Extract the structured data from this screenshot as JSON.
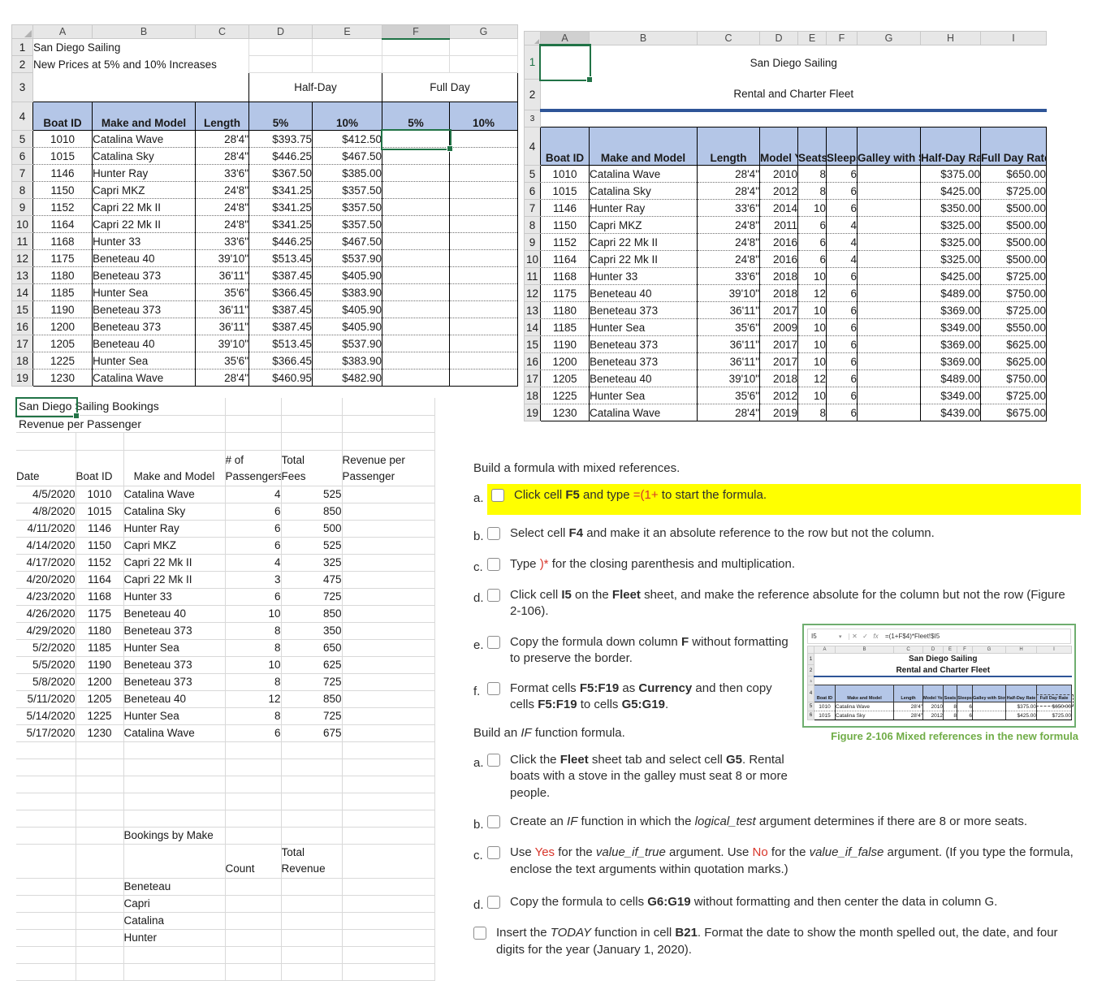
{
  "colors": {
    "selection_green": "#217346",
    "header_fill_blue": "#b4c6e7",
    "title_rule_blue": "#2e5597",
    "highlight_yellow": "#ffff00",
    "red_text": "#d8352a",
    "caption_green": "#70ad47"
  },
  "price_sheet": {
    "cols": [
      "A",
      "B",
      "C",
      "D",
      "E",
      "F",
      "G"
    ],
    "gutter": [
      "1",
      "2",
      "3",
      "4"
    ],
    "title": "San Diego Sailing",
    "subtitle": "New Prices at 5% and 10% Increases",
    "group_half": "Half-Day",
    "group_full": "Full Day",
    "headers": [
      "Boat ID",
      "Make and Model",
      "Length",
      "5%",
      "10%",
      "5%",
      "10%"
    ],
    "rows": [
      [
        "5",
        "1010",
        "Catalina Wave",
        "28'4\"",
        "$393.75",
        "$412.50"
      ],
      [
        "6",
        "1015",
        "Catalina Sky",
        "28'4\"",
        "$446.25",
        "$467.50"
      ],
      [
        "7",
        "1146",
        "Hunter Ray",
        "33'6\"",
        "$367.50",
        "$385.00"
      ],
      [
        "8",
        "1150",
        "Capri MKZ",
        "24'8\"",
        "$341.25",
        "$357.50"
      ],
      [
        "9",
        "1152",
        "Capri 22 Mk II",
        "24'8\"",
        "$341.25",
        "$357.50"
      ],
      [
        "10",
        "1164",
        "Capri 22 Mk II",
        "24'8\"",
        "$341.25",
        "$357.50"
      ],
      [
        "11",
        "1168",
        "Hunter 33",
        "33'6\"",
        "$446.25",
        "$467.50"
      ],
      [
        "12",
        "1175",
        "Beneteau 40",
        "39'10\"",
        "$513.45",
        "$537.90"
      ],
      [
        "13",
        "1180",
        "Beneteau 373",
        "36'11\"",
        "$387.45",
        "$405.90"
      ],
      [
        "14",
        "1185",
        "Hunter Sea",
        "35'6\"",
        "$366.45",
        "$383.90"
      ],
      [
        "15",
        "1190",
        "Beneteau 373",
        "36'11\"",
        "$387.45",
        "$405.90"
      ],
      [
        "16",
        "1200",
        "Beneteau 373",
        "36'11\"",
        "$387.45",
        "$405.90"
      ],
      [
        "17",
        "1205",
        "Beneteau 40",
        "39'10\"",
        "$513.45",
        "$537.90"
      ],
      [
        "18",
        "1225",
        "Hunter Sea",
        "35'6\"",
        "$366.45",
        "$383.90"
      ],
      [
        "19",
        "1230",
        "Catalina Wave",
        "28'4\"",
        "$460.95",
        "$482.90"
      ]
    ]
  },
  "fleet_sheet": {
    "cols": [
      "A",
      "B",
      "C",
      "D",
      "E",
      "F",
      "G",
      "H",
      "I"
    ],
    "gutter": [
      "1",
      "2",
      "3",
      "4"
    ],
    "title": "San Diego Sailing",
    "subtitle": "Rental and Charter Fleet",
    "headers": [
      "Boat ID",
      "Make and Model",
      "Length",
      "Model\nYear",
      "Seats",
      "Sleeps",
      "Galley\nwith Stove",
      "Half-Day\nRate",
      "Full Day\nRate"
    ],
    "rows": [
      [
        "5",
        "1010",
        "Catalina Wave",
        "28'4\"",
        "2010",
        "8",
        "6",
        "",
        "$375.00",
        "$650.00"
      ],
      [
        "6",
        "1015",
        "Catalina Sky",
        "28'4\"",
        "2012",
        "8",
        "6",
        "",
        "$425.00",
        "$725.00"
      ],
      [
        "7",
        "1146",
        "Hunter Ray",
        "33'6\"",
        "2014",
        "10",
        "6",
        "",
        "$350.00",
        "$500.00"
      ],
      [
        "8",
        "1150",
        "Capri MKZ",
        "24'8\"",
        "2011",
        "6",
        "4",
        "",
        "$325.00",
        "$500.00"
      ],
      [
        "9",
        "1152",
        "Capri 22 Mk II",
        "24'8\"",
        "2016",
        "6",
        "4",
        "",
        "$325.00",
        "$500.00"
      ],
      [
        "10",
        "1164",
        "Capri 22 Mk II",
        "24'8\"",
        "2016",
        "6",
        "4",
        "",
        "$325.00",
        "$500.00"
      ],
      [
        "11",
        "1168",
        "Hunter 33",
        "33'6\"",
        "2018",
        "10",
        "6",
        "",
        "$425.00",
        "$725.00"
      ],
      [
        "12",
        "1175",
        "Beneteau 40",
        "39'10\"",
        "2018",
        "12",
        "6",
        "",
        "$489.00",
        "$750.00"
      ],
      [
        "13",
        "1180",
        "Beneteau 373",
        "36'11\"",
        "2017",
        "10",
        "6",
        "",
        "$369.00",
        "$725.00"
      ],
      [
        "14",
        "1185",
        "Hunter Sea",
        "35'6\"",
        "2009",
        "10",
        "6",
        "",
        "$349.00",
        "$550.00"
      ],
      [
        "15",
        "1190",
        "Beneteau 373",
        "36'11\"",
        "2017",
        "10",
        "6",
        "",
        "$369.00",
        "$625.00"
      ],
      [
        "16",
        "1200",
        "Beneteau 373",
        "36'11\"",
        "2017",
        "10",
        "6",
        "",
        "$369.00",
        "$625.00"
      ],
      [
        "17",
        "1205",
        "Beneteau 40",
        "39'10\"",
        "2018",
        "12",
        "6",
        "",
        "$489.00",
        "$750.00"
      ],
      [
        "18",
        "1225",
        "Hunter Sea",
        "35'6\"",
        "2012",
        "10",
        "6",
        "",
        "$349.00",
        "$725.00"
      ],
      [
        "19",
        "1230",
        "Catalina Wave",
        "28'4\"",
        "2019",
        "8",
        "6",
        "",
        "$439.00",
        "$675.00"
      ]
    ]
  },
  "bookings_sheet": {
    "title": "San Diego Sailing Bookings",
    "subtitle": "Revenue per Passenger",
    "headers": [
      "Date",
      "Boat ID",
      "Make and Model",
      "# of\nPassengers",
      "Total\nFees",
      "Revenue per\nPassenger"
    ],
    "rows": [
      [
        "4/5/2020",
        "1010",
        "Catalina Wave",
        "4",
        "525",
        ""
      ],
      [
        "4/8/2020",
        "1015",
        "Catalina Sky",
        "6",
        "850",
        ""
      ],
      [
        "4/11/2020",
        "1146",
        "Hunter Ray",
        "6",
        "500",
        ""
      ],
      [
        "4/14/2020",
        "1150",
        "Capri MKZ",
        "6",
        "525",
        ""
      ],
      [
        "4/17/2020",
        "1152",
        "Capri 22 Mk II",
        "4",
        "325",
        ""
      ],
      [
        "4/20/2020",
        "1164",
        "Capri 22 Mk II",
        "3",
        "475",
        ""
      ],
      [
        "4/23/2020",
        "1168",
        "Hunter 33",
        "6",
        "725",
        ""
      ],
      [
        "4/26/2020",
        "1175",
        "Beneteau 40",
        "10",
        "850",
        ""
      ],
      [
        "4/29/2020",
        "1180",
        "Beneteau 373",
        "8",
        "350",
        ""
      ],
      [
        "5/2/2020",
        "1185",
        "Hunter Sea",
        "8",
        "650",
        ""
      ],
      [
        "5/5/2020",
        "1190",
        "Beneteau 373",
        "10",
        "625",
        ""
      ],
      [
        "5/8/2020",
        "1200",
        "Beneteau 373",
        "8",
        "725",
        ""
      ],
      [
        "5/11/2020",
        "1205",
        "Beneteau 40",
        "12",
        "850",
        ""
      ],
      [
        "5/14/2020",
        "1225",
        "Hunter Sea",
        "8",
        "725",
        ""
      ],
      [
        "5/17/2020",
        "1230",
        "Catalina Wave",
        "6",
        "675",
        ""
      ]
    ],
    "blank_rows": [
      [
        "",
        "",
        "",
        "",
        "",
        ""
      ],
      [
        "",
        "",
        "",
        "",
        "",
        ""
      ],
      [
        "",
        "",
        "",
        "",
        "",
        ""
      ],
      [
        "",
        "",
        "",
        "",
        "",
        ""
      ],
      [
        "",
        "",
        "",
        "",
        "",
        ""
      ]
    ],
    "by_make": {
      "title": "Bookings by Make",
      "count_header": "Count",
      "revenue_header": "Total\nRevenue",
      "rows": [
        [
          "Beneteau",
          "",
          ""
        ],
        [
          "Capri",
          "",
          ""
        ],
        [
          "Catalina",
          "",
          ""
        ],
        [
          "Hunter",
          "",
          ""
        ]
      ]
    },
    "tail_rows": [
      [
        "",
        "",
        "",
        "",
        "",
        ""
      ],
      [
        "",
        "",
        "",
        "",
        "",
        ""
      ]
    ]
  },
  "instructions": {
    "section1": {
      "title": [
        {
          "t": "Build a formula with mixed references."
        }
      ],
      "items": [
        {
          "label": "a.",
          "segments": [
            {
              "t": "Click cell "
            },
            {
              "t": "F5",
              "b": 1
            },
            {
              "t": " and type "
            },
            {
              "t": "=(1+",
              "r": 1
            },
            {
              "t": " to start the formula."
            }
          ]
        },
        {
          "label": "b.",
          "segments": [
            {
              "t": "Select cell "
            },
            {
              "t": "F4",
              "b": 1
            },
            {
              "t": " and make it an absolute reference to the row but not the column."
            }
          ]
        },
        {
          "label": "c.",
          "segments": [
            {
              "t": "Type "
            },
            {
              "t": ")*",
              "r": 1
            },
            {
              "t": " for the closing parenthesis and multiplication."
            }
          ]
        },
        {
          "label": "d.",
          "segments": [
            {
              "t": "Click cell "
            },
            {
              "t": "I5",
              "b": 1
            },
            {
              "t": " on the "
            },
            {
              "t": "Fleet",
              "b": 1
            },
            {
              "t": " sheet, and make the reference absolute for the column but not the row (Figure 2-106)."
            }
          ]
        },
        {
          "label": "e.",
          "segments": [
            {
              "t": "Copy the formula down column "
            },
            {
              "t": "F",
              "b": 1
            },
            {
              "t": " without formatting to preserve the border."
            }
          ]
        },
        {
          "label": "f.",
          "segments": [
            {
              "t": "Format cells "
            },
            {
              "t": "F5:F19",
              "b": 1
            },
            {
              "t": " as "
            },
            {
              "t": "Currency",
              "b": 1
            },
            {
              "t": " and then copy cells "
            },
            {
              "t": "F5:F19",
              "b": 1
            },
            {
              "t": " to cells "
            },
            {
              "t": "G5:G19",
              "b": 1
            },
            {
              "t": "."
            }
          ]
        }
      ]
    },
    "section2": {
      "title": [
        {
          "t": "Build an "
        },
        {
          "t": "IF",
          "i": 1
        },
        {
          "t": " function formula."
        }
      ],
      "items": [
        {
          "label": "a.",
          "segments": [
            {
              "t": "Click the "
            },
            {
              "t": "Fleet",
              "b": 1
            },
            {
              "t": " sheet tab and select cell "
            },
            {
              "t": "G5",
              "b": 1
            },
            {
              "t": ". Rental boats with a stove in the galley must seat 8 or more people."
            }
          ]
        },
        {
          "label": "b.",
          "segments": [
            {
              "t": "Create an "
            },
            {
              "t": "IF",
              "i": 1
            },
            {
              "t": " function in which the "
            },
            {
              "t": "logical_test",
              "i": 1
            },
            {
              "t": " argument determines if there are 8 or more seats."
            }
          ]
        },
        {
          "label": "c.",
          "segments": [
            {
              "t": "Use "
            },
            {
              "t": "Yes",
              "r": 1
            },
            {
              "t": " for the "
            },
            {
              "t": "value_if_true",
              "i": 1
            },
            {
              "t": " argument. Use "
            },
            {
              "t": "No",
              "r": 1
            },
            {
              "t": " for the "
            },
            {
              "t": "value_if_false",
              "i": 1
            },
            {
              "t": " argument. (If you type the formula, enclose the text arguments within quotation marks.)"
            }
          ]
        },
        {
          "label": "d.",
          "segments": [
            {
              "t": "Copy the formula to cells "
            },
            {
              "t": "G6:G19",
              "b": 1
            },
            {
              "t": " without formatting and then center the data in column G."
            }
          ]
        }
      ]
    },
    "final_item": {
      "segments": [
        {
          "t": "Insert the "
        },
        {
          "t": "TODAY",
          "i": 1
        },
        {
          "t": " function in cell "
        },
        {
          "t": "B21",
          "b": 1
        },
        {
          "t": ". Format the date to show the month spelled out, the date, and four digits for the year (January 1, 2020)."
        }
      ]
    }
  },
  "figure": {
    "name_box": "I5",
    "formula": "=(1+F$4)*Fleet!$I5",
    "caption": "Figure 2-106 Mixed references in the new formula",
    "cols": [
      "A",
      "B",
      "C",
      "D",
      "E",
      "F",
      "G",
      "H",
      "I"
    ],
    "gutter": [
      "1",
      "2",
      "3",
      "4"
    ],
    "title": "San Diego Sailing",
    "subtitle": "Rental and Charter Fleet",
    "headers": [
      "Boat ID",
      "Make and Model",
      "Length",
      "Model\nYear",
      "Seats",
      "Sleeps",
      "Galley\nwith Stove",
      "Half-Day\nRate",
      "Full Day\nRate"
    ],
    "rows": [
      [
        "5",
        "1010",
        "Catalina Wave",
        "28'4\"",
        "2010",
        "8",
        "6",
        "",
        "$375.00",
        "$650.00"
      ],
      [
        "6",
        "1015",
        "Catalina Sky",
        "28'4\"",
        "2012",
        "8",
        "6",
        "",
        "$425.00",
        "$725.00"
      ]
    ]
  }
}
